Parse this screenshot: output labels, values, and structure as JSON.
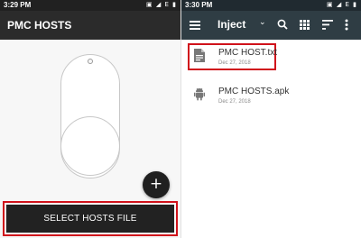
{
  "left_panel": {
    "status_bar": {
      "time": "3:29 PM",
      "icons": "▣ ◢ E ▮"
    },
    "app_title": "PMC HOSTS",
    "add_button_label": "+",
    "select_button_label": "SELECT HOSTS FILE"
  },
  "right_panel": {
    "status_bar": {
      "time": "3:30 PM",
      "icons": "▣ ◢ E ▮"
    },
    "toolbar": {
      "title": "Inject",
      "icons": [
        "menu-icon",
        "chevron-down-icon",
        "search-icon",
        "grid-icon",
        "sort-icon",
        "more-vert-icon"
      ]
    },
    "files": [
      {
        "name": "PMC HOST.txt",
        "date": "Dec 27, 2018",
        "icon": "document-icon",
        "highlighted": true
      },
      {
        "name": "PMC HOSTS.apk",
        "date": "Dec 27, 2018",
        "icon": "android-icon",
        "highlighted": false
      }
    ]
  },
  "colors": {
    "highlight": "#d0121b",
    "left_appbar": "#2b2b2b",
    "right_appbar": "#2f3d44",
    "button": "#222222"
  }
}
